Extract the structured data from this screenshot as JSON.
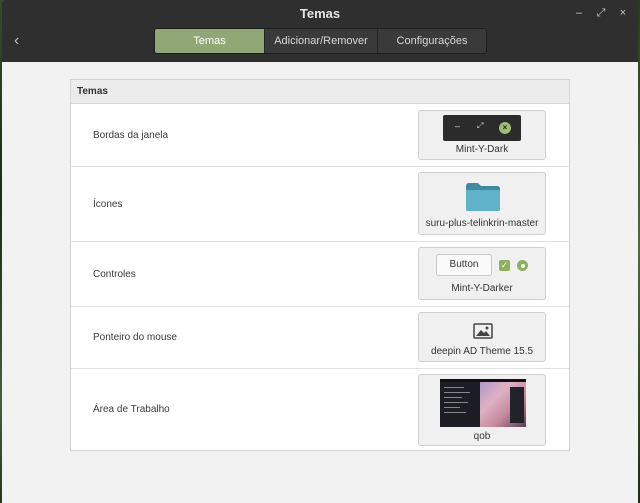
{
  "window": {
    "title": "Temas",
    "back_symbol": "‹",
    "controls": {
      "minimize": "–",
      "maximize": "⤢",
      "close": "×"
    }
  },
  "tabs": [
    {
      "label": "Temas",
      "active": true
    },
    {
      "label": "Adicionar/Remover",
      "active": false
    },
    {
      "label": "Configurações",
      "active": false
    }
  ],
  "panel": {
    "heading": "Temas",
    "rows": [
      {
        "label": "Bordas da janela",
        "value": "Mint-Y-Dark"
      },
      {
        "label": "Ícones",
        "value": "suru-plus-telinkrin-master"
      },
      {
        "label": "Controles",
        "value": "Mint-Y-Darker"
      },
      {
        "label": "Ponteiro do mouse",
        "value": "deepin AD Theme 15.5"
      },
      {
        "label": "Área de Trabalho",
        "value": "qob"
      }
    ]
  },
  "previews": {
    "button_label": "Button",
    "accent_color": "#8bb15e"
  },
  "colors": {
    "tab_active": "#8fa876",
    "titlebar": "#2f2f2f",
    "content_bg": "#f2f2f2"
  }
}
